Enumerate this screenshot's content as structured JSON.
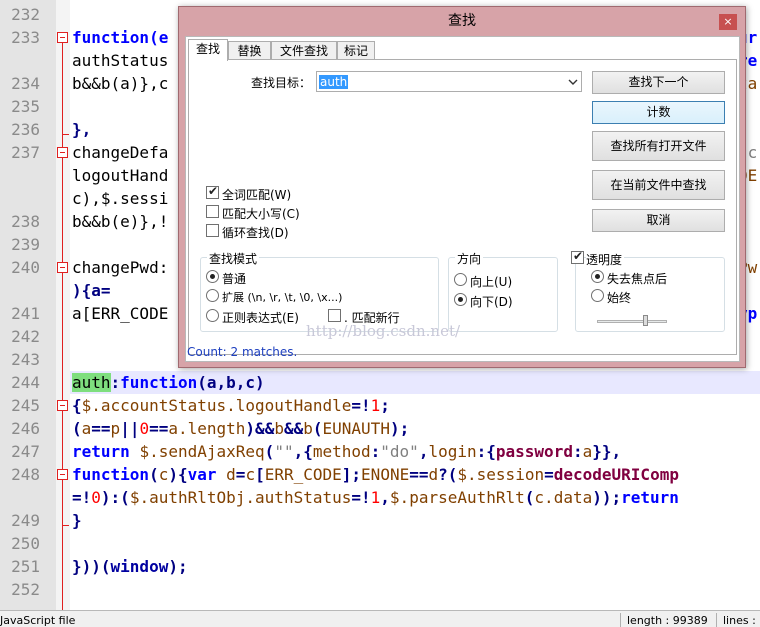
{
  "editor": {
    "lines": [
      {
        "num": "232",
        "text": ""
      },
      {
        "num": "233",
        "text": "function(e"
      },
      {
        "num": "",
        "text": "authStatus"
      },
      {
        "num": "234",
        "text": "b&&b(a)},c"
      },
      {
        "num": "235",
        "text": ""
      },
      {
        "num": "236",
        "text": "},"
      },
      {
        "num": "237",
        "text": "changeDefa"
      },
      {
        "num": "",
        "text": "logoutHand"
      },
      {
        "num": "",
        "text": "c),$.sessi"
      },
      {
        "num": "238",
        "text": "b&&b(e)},!"
      },
      {
        "num": "239",
        "text": ""
      },
      {
        "num": "240",
        "text": "changePwd:"
      },
      {
        "num": "",
        "text": "){a="
      },
      {
        "num": "241",
        "text": "a[ERR_CODE"
      },
      {
        "num": "242",
        "text": ""
      },
      {
        "num": "243",
        "text": ""
      },
      {
        "num": "244",
        "text": "auth:function(a,b,c)"
      },
      {
        "num": "245",
        "text": "{$.accountStatus.logoutHandle=!1;"
      },
      {
        "num": "246",
        "text": "(a==p||0==a.length)&&b&&b(EUNAUTH);"
      },
      {
        "num": "247",
        "text": "return $.sendAjaxReq(\"\",{method:\"do\",login:{password:a}},"
      },
      {
        "num": "248",
        "text": "function(c){var d=c[ERR_CODE];ENONE==d?($.session=decodeURIComp"
      },
      {
        "num": "",
        "text": "=!0):($.authRltObj.authStatus=!1,$.parseAuthRlt(c.data));return"
      },
      {
        "num": "249",
        "text": "}"
      },
      {
        "num": "250",
        "text": ""
      },
      {
        "num": "251",
        "text": "}))(window);"
      },
      {
        "num": "252",
        "text": ""
      }
    ],
    "right_fragments": [
      "ur",
      "re",
      "ta",
      "\"c",
      "DE",
      "Pw",
      "yp"
    ]
  },
  "status": {
    "file_type": "JavaScript file",
    "length": "length : 99389",
    "lines": "lines :"
  },
  "dialog": {
    "title": "查找",
    "close_glyph": "×",
    "tabs": [
      "查找",
      "替换",
      "文件查找",
      "标记"
    ],
    "find_label": "查找目标：",
    "find_value": "auth",
    "buttons": {
      "find_next": "查找下一个",
      "count": "计数",
      "find_all_open": "查找所有打开文件",
      "find_in_current": "在当前文件中查找",
      "cancel": "取消"
    },
    "options": {
      "whole_word": "全词匹配(W)",
      "match_case": "匹配大小写(C)",
      "wrap_around": "循环查找(D)"
    },
    "search_mode": {
      "title": "查找模式",
      "normal": "普通",
      "extended": "扩展 (\\n, \\r, \\t, \\0, \\x...)",
      "regex": "正则表达式(E)",
      "dot_newline": ". 匹配新行"
    },
    "direction": {
      "title": "方向",
      "up": "向上(U)",
      "down": "向下(D)"
    },
    "transparency": {
      "title": "透明度",
      "on_lose_focus": "失去焦点后",
      "always": "始终"
    },
    "watermark": "http://blog.csdn.net/",
    "count_message": "Count: 2 matches."
  },
  "colors": {
    "dialog_frame": "#d7a3a8",
    "match_highlight": "#7ede7e",
    "keyword": "#0000ff",
    "number": "#ff0000",
    "count_text": "#1d3fbf"
  }
}
